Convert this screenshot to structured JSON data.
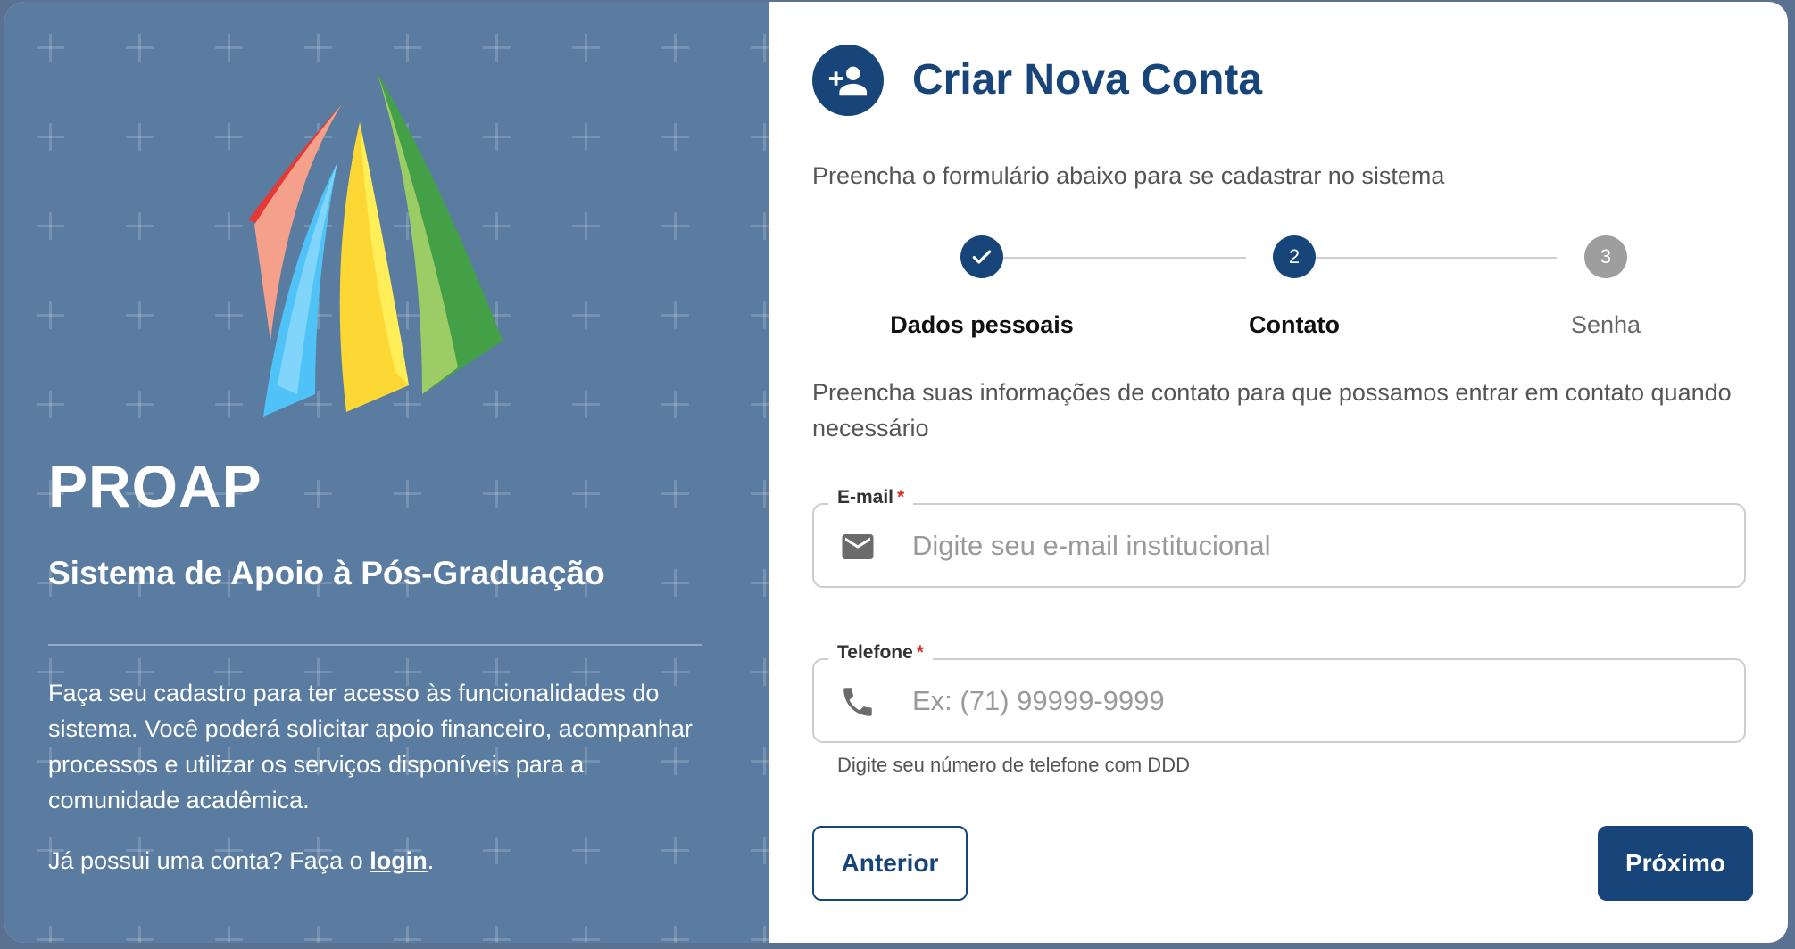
{
  "brand": {
    "title": "PROAP",
    "subtitle": "Sistema de Apoio à Pós-Graduação",
    "description": "Faça seu cadastro para ter acesso às funcionalidades do sistema. Você poderá solicitar apoio financeiro, acompanhar processos e utilizar os serviços disponíveis para a comunidade acadêmica.",
    "login_prefix": "Já possui uma conta? Faça o ",
    "login_link": "login",
    "login_suffix": ".",
    "logo_colors": [
      "#e53935",
      "#f4a08a",
      "#4fc3f7",
      "#81d4fa",
      "#fdd835",
      "#ffee58",
      "#43a047",
      "#9ccc65"
    ]
  },
  "form": {
    "title": "Criar Nova Conta",
    "description": "Preencha o formulário abaixo para se cadastrar no sistema",
    "steps": [
      {
        "number": "1",
        "label": "Dados pessoais",
        "state": "completed"
      },
      {
        "number": "2",
        "label": "Contato",
        "state": "active"
      },
      {
        "number": "3",
        "label": "Senha",
        "state": "pending"
      }
    ],
    "contact_description": "Preencha suas informações de contato para que possamos entrar em contato quando necessário",
    "email": {
      "label": "E-mail",
      "required": "*",
      "placeholder": "Digite seu e-mail institucional",
      "value": "",
      "icon": "email-icon"
    },
    "phone": {
      "label": "Telefone",
      "required": "*",
      "placeholder": "Ex: (71) 99999-9999",
      "value": "",
      "helper": "Digite seu número de telefone com DDD",
      "icon": "phone-icon"
    },
    "prev_label": "Anterior",
    "next_label": "Próximo"
  },
  "colors": {
    "primary": "#17457a",
    "pending": "#9e9e9e",
    "required": "#d32f2f"
  }
}
